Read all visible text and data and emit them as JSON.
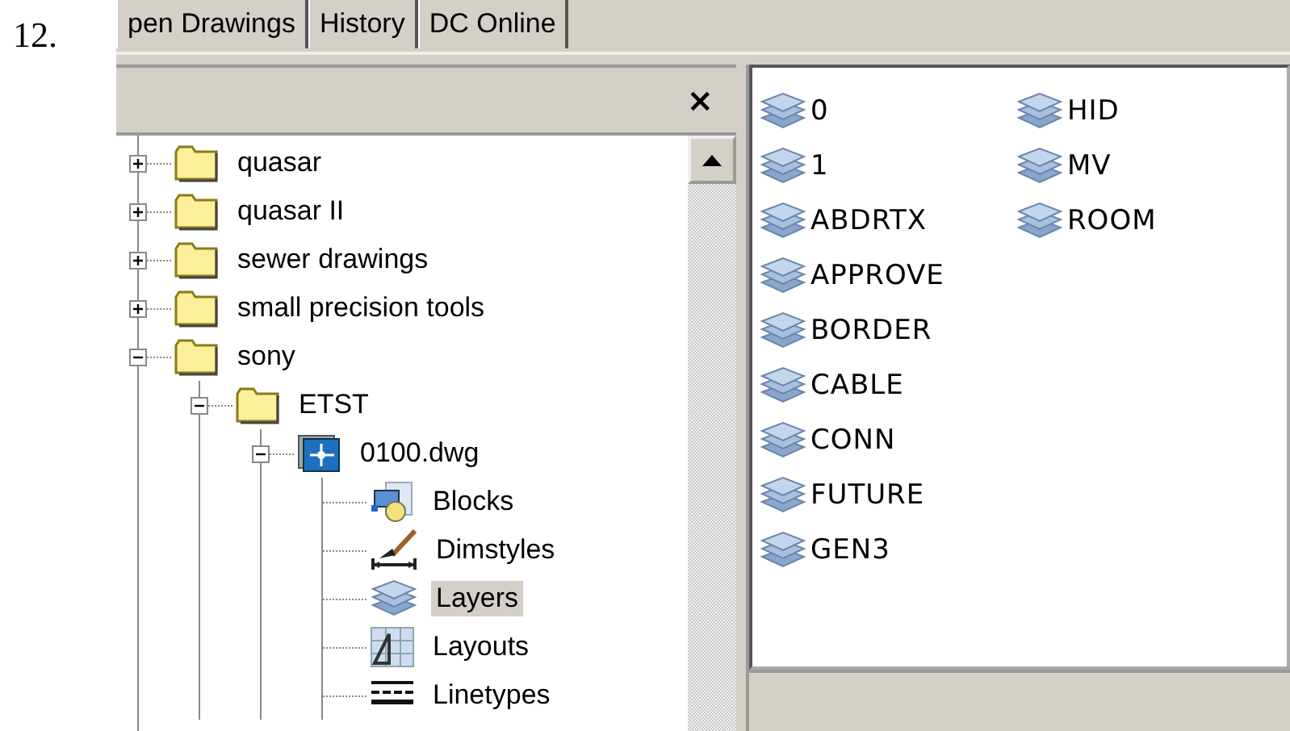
{
  "label": "12.",
  "tabs": [
    {
      "label": "pen Drawings"
    },
    {
      "label": "History"
    },
    {
      "label": "DC Online"
    }
  ],
  "tree": {
    "close": "×",
    "items": [
      {
        "label": "quasar",
        "kind": "folder",
        "expanded": false,
        "selected": false
      },
      {
        "label": "quasar II",
        "kind": "folder",
        "expanded": false,
        "selected": false
      },
      {
        "label": "sewer drawings",
        "kind": "folder",
        "expanded": false,
        "selected": false
      },
      {
        "label": "small precision tools",
        "kind": "folder",
        "expanded": false,
        "selected": false
      },
      {
        "label": "sony",
        "kind": "folder",
        "expanded": true,
        "selected": false,
        "children": [
          {
            "label": "ETST",
            "kind": "folder",
            "expanded": true,
            "selected": false,
            "children": [
              {
                "label": "0100.dwg",
                "kind": "drawing",
                "expanded": true,
                "selected": false,
                "children": [
                  {
                    "label": "Blocks",
                    "kind": "blocks",
                    "selected": false
                  },
                  {
                    "label": "Dimstyles",
                    "kind": "dimstyles",
                    "selected": false
                  },
                  {
                    "label": "Layers",
                    "kind": "layers",
                    "selected": true
                  },
                  {
                    "label": "Layouts",
                    "kind": "layouts",
                    "selected": false
                  },
                  {
                    "label": "Linetypes",
                    "kind": "linetypes",
                    "selected": false
                  }
                ]
              }
            ]
          }
        ]
      }
    ]
  },
  "layers": [
    "0",
    "1",
    "ABDRTX",
    "APPROVE",
    "BORDER",
    "CABLE",
    "CONN",
    "FUTURE",
    "GEN3",
    "HID",
    "MV",
    "ROOM"
  ]
}
